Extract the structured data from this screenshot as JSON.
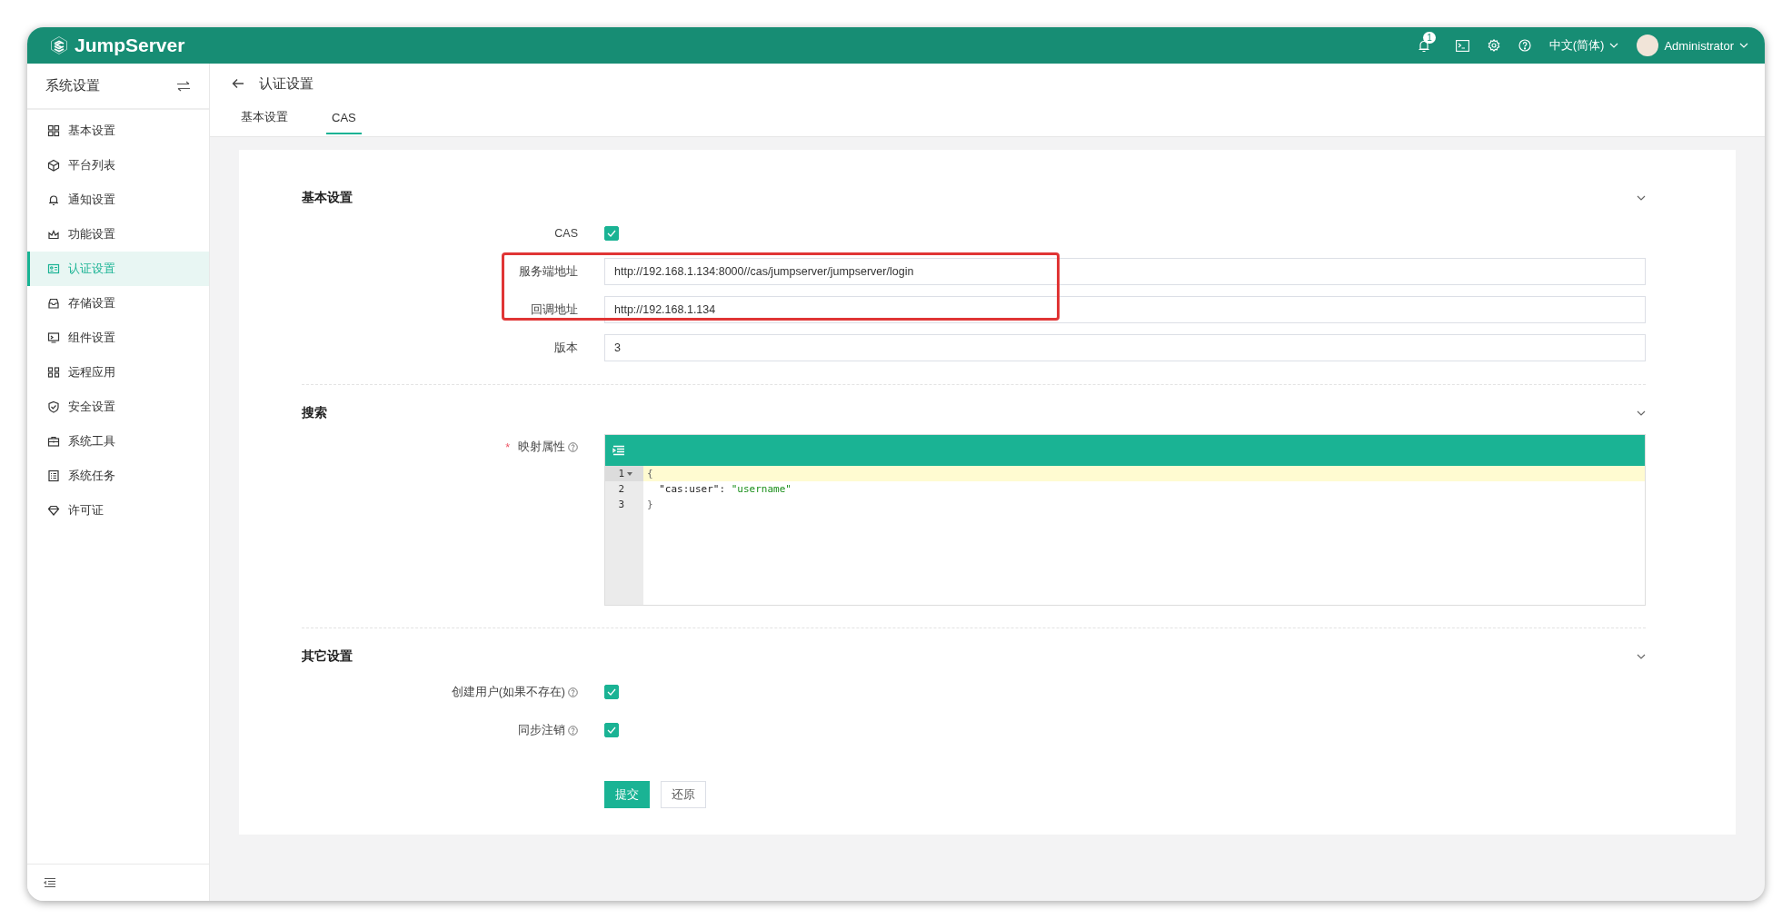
{
  "header": {
    "brand": "JumpServer",
    "notifications": {
      "badge": "1"
    },
    "language": "中文(简体)",
    "user": "Administrator"
  },
  "sidebar": {
    "title": "系统设置",
    "items": [
      {
        "label": "基本设置",
        "selected": false
      },
      {
        "label": "平台列表",
        "selected": false
      },
      {
        "label": "通知设置",
        "selected": false
      },
      {
        "label": "功能设置",
        "selected": false
      },
      {
        "label": "认证设置",
        "selected": true
      },
      {
        "label": "存储设置",
        "selected": false
      },
      {
        "label": "组件设置",
        "selected": false
      },
      {
        "label": "远程应用",
        "selected": false
      },
      {
        "label": "安全设置",
        "selected": false
      },
      {
        "label": "系统工具",
        "selected": false
      },
      {
        "label": "系统任务",
        "selected": false
      },
      {
        "label": "许可证",
        "selected": false
      }
    ]
  },
  "page": {
    "title": "认证设置",
    "tabs": [
      {
        "label": "基本设置",
        "selected": false
      },
      {
        "label": "CAS",
        "selected": true
      }
    ]
  },
  "sections": [
    {
      "title": "基本设置",
      "expanded": true,
      "rows": [
        {
          "kind": "checkbox",
          "label": "CAS",
          "checked": true
        },
        {
          "kind": "input",
          "label": "服务端地址",
          "value": "http://192.168.1.134:8000//cas/jumpserver/jumpserver/login",
          "highlighted": true
        },
        {
          "kind": "input",
          "label": "回调地址",
          "value": "http://192.168.1.134",
          "highlighted": true
        },
        {
          "kind": "input",
          "label": "版本",
          "value": "3",
          "highlighted": false
        }
      ]
    },
    {
      "title": "搜索",
      "expanded": true,
      "rows": [
        {
          "kind": "editor",
          "label": "映射属性",
          "required_mark": "*",
          "help": true,
          "lines": [
            {
              "number": "1",
              "foldable": true,
              "active": true,
              "tokens": [
                {
                  "kind": "punct",
                  "text": "{"
                }
              ]
            },
            {
              "number": "2",
              "foldable": false,
              "active": false,
              "tokens": [
                {
                  "kind": "key",
                  "text": "  \"cas:user\": "
                },
                {
                  "kind": "string",
                  "text": "\"username\""
                }
              ]
            },
            {
              "number": "3",
              "foldable": false,
              "active": false,
              "tokens": [
                {
                  "kind": "punct",
                  "text": "}"
                }
              ]
            }
          ]
        }
      ]
    },
    {
      "title": "其它设置",
      "expanded": true,
      "rows": [
        {
          "kind": "checkbox",
          "label": "创建用户(如果不存在)",
          "help": true,
          "checked": true
        },
        {
          "kind": "checkbox",
          "label": "同步注销",
          "help": true,
          "checked": true
        }
      ]
    }
  ],
  "buttons": [
    {
      "label": "提交",
      "kind": "primary"
    },
    {
      "label": "还原",
      "kind": "default"
    }
  ]
}
